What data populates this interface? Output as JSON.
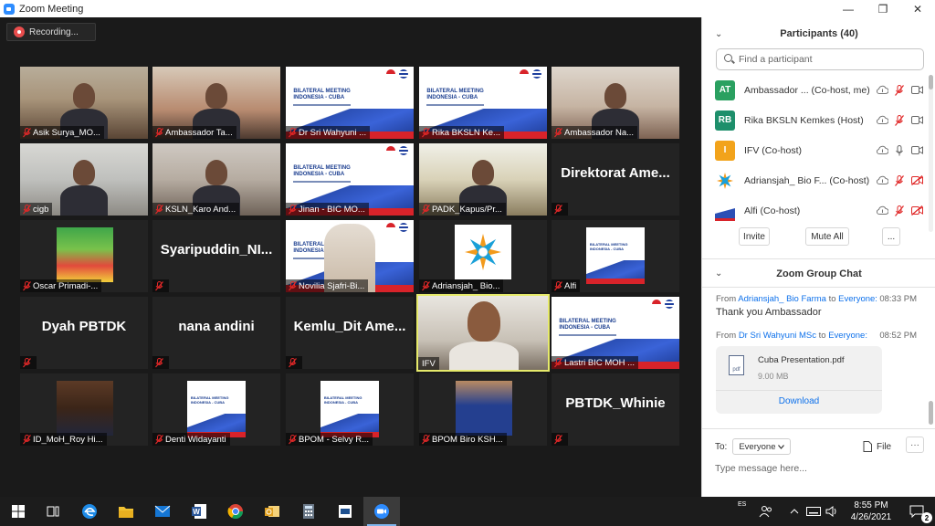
{
  "window": {
    "title": "Zoom Meeting",
    "minimize": "—",
    "maximize": "❐",
    "close": "✕"
  },
  "recording": {
    "label": "Recording..."
  },
  "tiles": [
    {
      "name": "Asik Surya_MO...",
      "kind": "video"
    },
    {
      "name": "Ambassador Ta...",
      "kind": "video"
    },
    {
      "name": "Dr Sri Wahyuni ...",
      "kind": "slide"
    },
    {
      "name": "Rika BKSLN Ke...",
      "kind": "slide"
    },
    {
      "name": "Ambassador Na...",
      "kind": "video"
    },
    {
      "name": "cigb",
      "kind": "video"
    },
    {
      "name": "KSLN_Karo And...",
      "kind": "video"
    },
    {
      "name": "Jinan - BIC MO...",
      "kind": "slide"
    },
    {
      "name": "PADK_Kapus/Pr...",
      "kind": "video"
    },
    {
      "name": "",
      "kind": "text",
      "big": "Direktorat Ame..."
    },
    {
      "name": "Oscar Primadi-...",
      "kind": "image"
    },
    {
      "name": "",
      "kind": "text",
      "big": "Syaripuddin_NI..."
    },
    {
      "name": "Novilia Sjafri-Bi...",
      "kind": "video-slide"
    },
    {
      "name": "Adriansjah_ Bio...",
      "kind": "logo"
    },
    {
      "name": "Alfi",
      "kind": "slide-small"
    },
    {
      "name": "",
      "kind": "text",
      "big": "Dyah PBTDK"
    },
    {
      "name": "",
      "kind": "text",
      "big": "nana andini"
    },
    {
      "name": "",
      "kind": "text",
      "big": "Kemlu_Dit Ame..."
    },
    {
      "name": "IFV",
      "kind": "speaker"
    },
    {
      "name": "Lastri BIC MOH ...",
      "kind": "slide"
    },
    {
      "name": "ID_MoH_Roy Hi...",
      "kind": "image-person"
    },
    {
      "name": "Denti Widayanti",
      "kind": "slide-small"
    },
    {
      "name": "BPOM - Selvy R...",
      "kind": "slide-small"
    },
    {
      "name": "BPOM Biro KSH...",
      "kind": "image-person2"
    },
    {
      "name": "",
      "kind": "text",
      "big": "PBTDK_Whinie"
    }
  ],
  "slide_text": {
    "line1": "BILATERAL MEETING",
    "line2": "INDONESIA - CUBA"
  },
  "participants": {
    "title": "Participants (40)",
    "search_placeholder": "Find a participant",
    "list": [
      {
        "initials": "AT",
        "name": "Ambassador ... (Co-host, me)",
        "color": "#2aa060",
        "mic": "muted",
        "cam": "on"
      },
      {
        "initials": "RB",
        "name": "Rika BKSLN Kemkes (Host)",
        "color": "#1e8f6b",
        "mic": "muted",
        "cam": "on"
      },
      {
        "initials": "I",
        "name": "IFV (Co-host)",
        "color": "#f2a31b",
        "mic": "on",
        "cam": "on"
      },
      {
        "initials": "",
        "name": "Adriansjah_ Bio F... (Co-host)",
        "color": "#ffffff",
        "mic": "muted",
        "cam": "off"
      },
      {
        "initials": "",
        "name": "Alfi (Co-host)",
        "color": "#ffffff",
        "mic": "muted",
        "cam": "off"
      }
    ],
    "invite": "Invite",
    "mute_all": "Mute All",
    "more": "..."
  },
  "chat": {
    "title": "Zoom Group Chat",
    "messages": [
      {
        "from_label": "From",
        "from": "Adriansjah_ Bio Farma",
        "to_label": "to",
        "to": "Everyone:",
        "time": "08:33 PM",
        "text": "Thank you Ambassador"
      },
      {
        "from_label": "From",
        "from": "Dr Sri Wahyuni MSc",
        "to_label": "to",
        "to": "Everyone:",
        "time": "08:52 PM",
        "text": ""
      }
    ],
    "file": {
      "name": "Cuba Presentation.pdf",
      "size": "9.00 MB",
      "download": "Download",
      "type": "pdf"
    },
    "to_label": "To:",
    "to_value": "Everyone",
    "file_button": "File",
    "more_button": "···",
    "input_placeholder": "Type message here..."
  },
  "taskbar": {
    "language": "ES",
    "time": "8:55 PM",
    "date": "4/26/2021",
    "notifications": "2"
  },
  "colors": {
    "accent": "#0e71eb",
    "speaking_border": "#e6ea6b",
    "muted_red": "#e02828"
  }
}
